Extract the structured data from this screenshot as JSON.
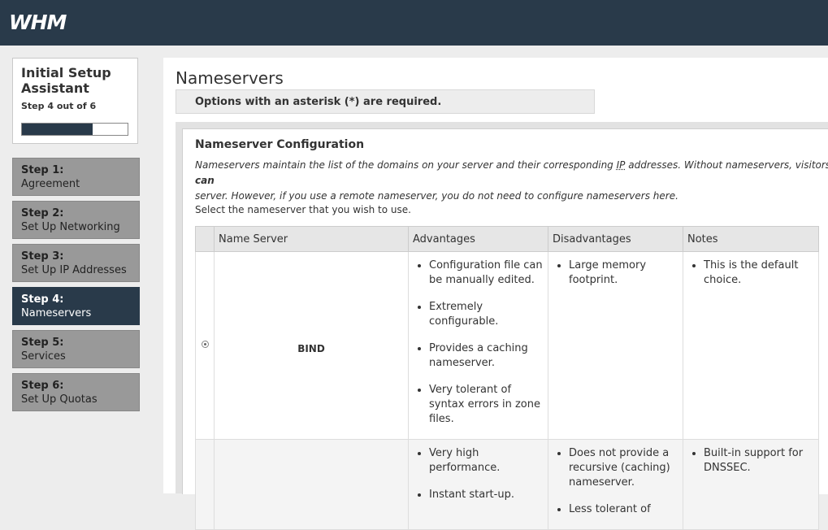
{
  "header": {
    "logo": "WHM"
  },
  "setup": {
    "title": "Initial Setup Assistant",
    "step_text": "Step 4 out of 6",
    "progress_fraction": 0.67
  },
  "steps": [
    {
      "num": "Step 1:",
      "label": "Agreement"
    },
    {
      "num": "Step 2:",
      "label": "Set Up Networking"
    },
    {
      "num": "Step 3:",
      "label": "Set Up IP Addresses"
    },
    {
      "num": "Step 4:",
      "label": "Nameservers"
    },
    {
      "num": "Step 5:",
      "label": "Services"
    },
    {
      "num": "Step 6:",
      "label": "Set Up Quotas"
    }
  ],
  "active_step": 3,
  "main": {
    "title": "Nameservers",
    "notice": "Options with an asterisk (*) are required.",
    "section_title": "Nameserver Configuration",
    "desc_1": "Nameservers maintain the list of the domains on your server and their corresponding",
    "desc_ip": "IP",
    "desc_2": "addresses. Without nameservers, visitors",
    "desc_bold": "can",
    "desc_3": "server. However, if you use a remote nameserver, you do not need to configure nameservers here.",
    "select_text": "Select the nameserver that you wish to use."
  },
  "table": {
    "headers": [
      "Name Server",
      "Advantages",
      "Disadvantages",
      "Notes"
    ],
    "rows": [
      {
        "name": "BIND",
        "selected": true,
        "advantages": [
          "Configuration file can be manually edited.",
          "Extremely configurable.",
          "Provides a caching nameserver.",
          "Very tolerant of syntax errors in zone files."
        ],
        "disadvantages": [
          "Large memory footprint."
        ],
        "notes": [
          "This is the default choice."
        ]
      },
      {
        "name": "",
        "selected": false,
        "advantages": [
          "Very high performance.",
          "Instant start-up."
        ],
        "disadvantages": [
          "Does not provide a recursive (caching) nameserver.",
          "Less tolerant of"
        ],
        "notes": [
          "Built-in support for DNSSEC."
        ]
      }
    ]
  }
}
